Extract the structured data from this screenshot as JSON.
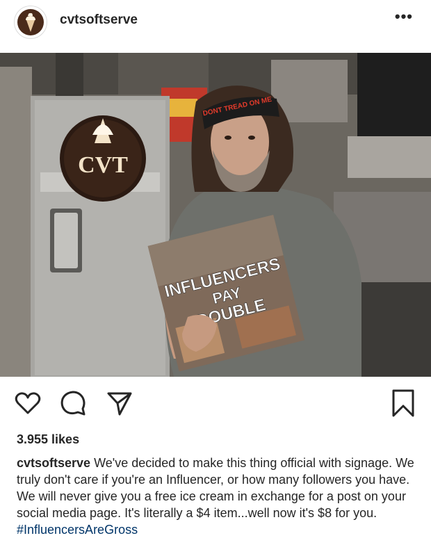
{
  "post": {
    "username": "cvtsoftserve",
    "more_label": "•••",
    "likes": "3.955 likes",
    "caption_text": "We've decided to make this thing official with signage. We truly don't care if you're an Influencer, or how many followers you have. We will never give you a free ice cream in exchange for a post on your social media page. It's literally a $4 item...well now it's $8 for you.",
    "hashtag": "#InfluencersAreGross"
  },
  "photo": {
    "sign_line1": "INFLUENCERS",
    "sign_line2": "PAY",
    "sign_line3": "DOUBLE",
    "logo_text": "CVT",
    "headband_text": "DONT TREAD ON ME"
  },
  "icons": {
    "like": "heart-icon",
    "comment": "comment-icon",
    "share": "send-icon",
    "save": "bookmark-icon"
  },
  "colors": {
    "text": "#262626",
    "hashtag": "#003569",
    "divider": "#dbdbdb"
  }
}
